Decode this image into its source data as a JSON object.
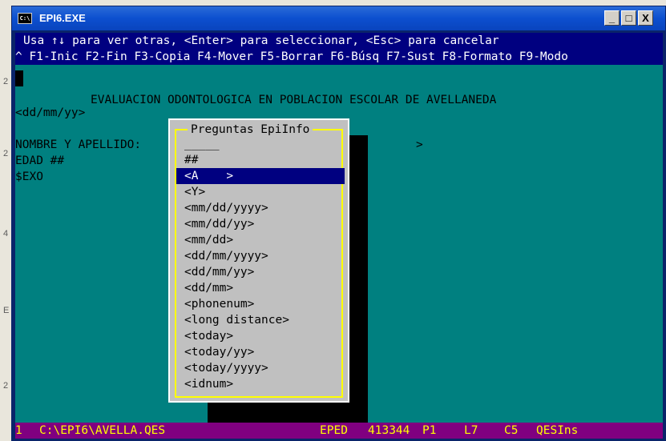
{
  "window": {
    "title": "EPI6.EXE",
    "icon_label": "C:\\",
    "buttons": {
      "minimize": "_",
      "maximize": "□",
      "close": "X"
    }
  },
  "help_line": "Usa ↑↓ para ver otras, <Enter> para seleccionar, <Esc> para cancelar",
  "fkeys": {
    "prefix": "^",
    "items": [
      {
        "key": "F1",
        "label": "-Inic"
      },
      {
        "key": "F2",
        "label": "-Fin"
      },
      {
        "key": "F3",
        "label": "-Copia"
      },
      {
        "key": "F4",
        "label": "-Mover"
      },
      {
        "key": "F5",
        "label": "-Borrar"
      },
      {
        "key": "F6",
        "label": "-Búsq"
      },
      {
        "key": "F7",
        "label": "-Sust"
      },
      {
        "key": "F8",
        "label": "-Formato"
      },
      {
        "key": "F9",
        "label": "-Modo"
      }
    ]
  },
  "form": {
    "heading": "EVALUACION ODONTOLOGICA EN POBLACION ESCOLAR DE AVELLANEDA",
    "date_field": "<dd/mm/yy>",
    "nombre_label": "NOMBRE Y APELLIDO:",
    "nombre_end": ">",
    "edad_label": "EDAD ##",
    "sexo_label": "$EXO"
  },
  "dialog": {
    "title": "Preguntas EpiInfo",
    "items": [
      "_____",
      "##",
      "<A    >",
      "<Y>",
      "<mm/dd/yyyy>",
      "<mm/dd/yy>",
      "<mm/dd>",
      "<dd/mm/yyyy>",
      "<dd/mm/yy>",
      "<dd/mm>",
      "<phonenum>",
      "<long distance>",
      "<today>",
      "<today/yy>",
      "<today/yyyy>",
      "<idnum>"
    ],
    "selected_index": 2
  },
  "status": {
    "line": "1",
    "path": "C:\\EPI6\\AVELLA.QES",
    "mode": "EPED",
    "memory": "413344",
    "page": "P1",
    "row": "L7",
    "col": "C5",
    "insert": "QESIns"
  },
  "desktop": {
    "left_numbers": [
      "2",
      "2",
      "4",
      "E",
      "2"
    ]
  },
  "colors": {
    "console_bg": "#008080",
    "highlight": "#000080",
    "status_bg": "#800080",
    "status_fg": "#ffff00",
    "dialog_border": "#ffff00"
  }
}
